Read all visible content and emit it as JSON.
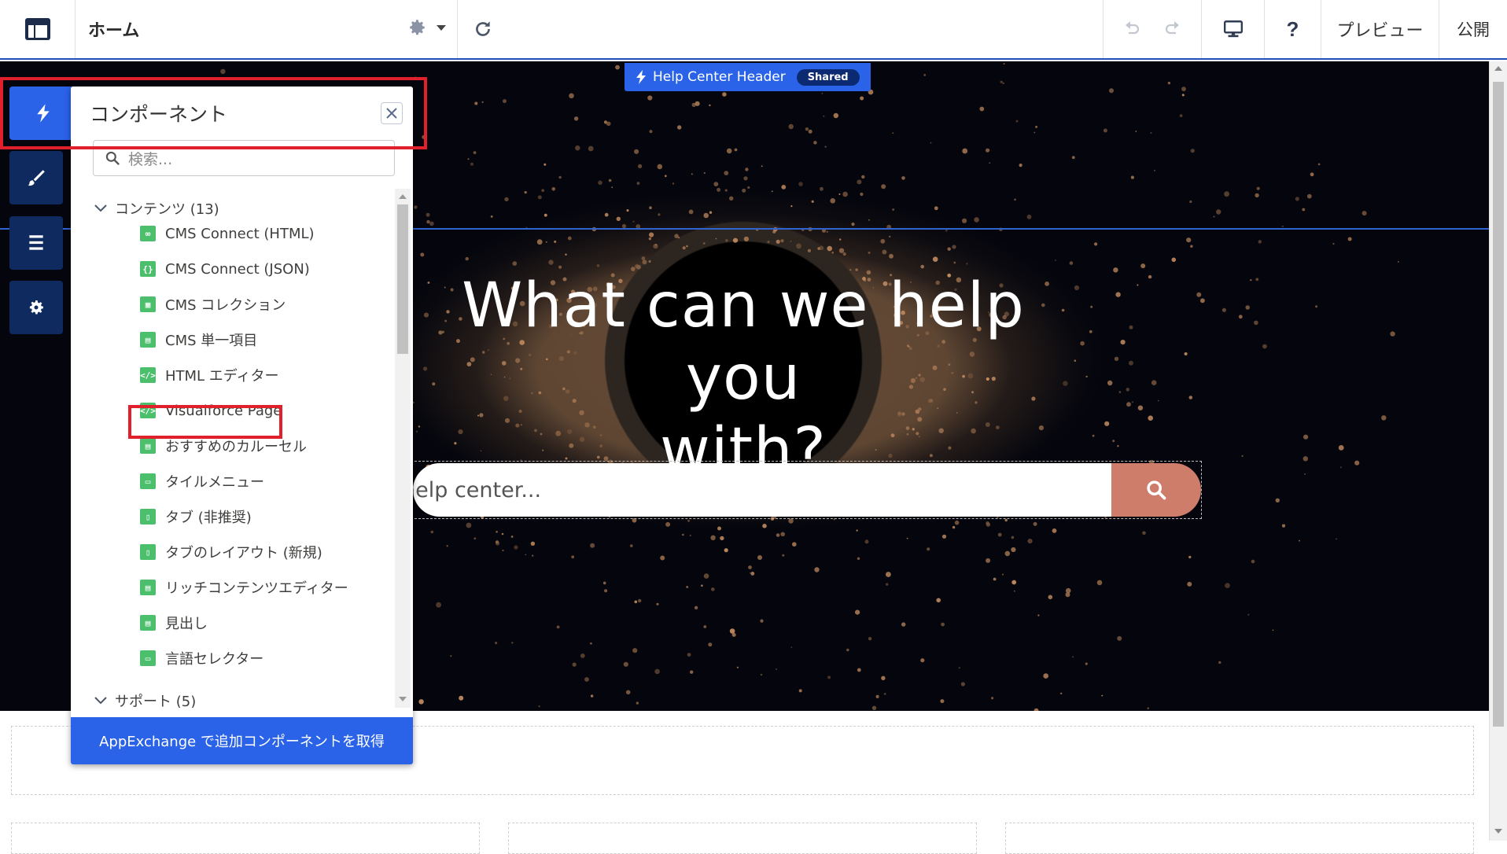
{
  "toolbar": {
    "page_name": "ホーム",
    "preview_label": "プレビュー",
    "publish_label": "公開"
  },
  "canvas": {
    "header_tag_label": "Help Center Header",
    "shared_badge": "Shared",
    "hero_title_line1": "What can we help you",
    "hero_title_line2": "with?",
    "search_placeholder": "help center..."
  },
  "panel": {
    "title": "コンポーネント",
    "search_placeholder": "検索...",
    "categories": [
      {
        "label": "コンテンツ (13)"
      },
      {
        "label": "サポート (5)"
      }
    ],
    "items": [
      {
        "label": "CMS Connect (HTML)",
        "icon": "cms-connect-html-icon"
      },
      {
        "label": "CMS Connect (JSON)",
        "icon": "cms-connect-json-icon"
      },
      {
        "label": "CMS コレクション",
        "icon": "cms-collection-icon"
      },
      {
        "label": "CMS 単一項目",
        "icon": "cms-single-item-icon"
      },
      {
        "label": "HTML エディター",
        "icon": "html-editor-icon"
      },
      {
        "label": "Visualforce Page",
        "icon": "visualforce-page-icon"
      },
      {
        "label": "おすすめのカルーセル",
        "icon": "carousel-icon"
      },
      {
        "label": "タイルメニュー",
        "icon": "tile-menu-icon"
      },
      {
        "label": "タブ (非推奨)",
        "icon": "tabs-icon"
      },
      {
        "label": "タブのレイアウト (新規)",
        "icon": "tabs-layout-icon"
      },
      {
        "label": "リッチコンテンツエディター",
        "icon": "rich-content-editor-icon"
      },
      {
        "label": "見出し",
        "icon": "heading-icon"
      },
      {
        "label": "言語セレクター",
        "icon": "language-selector-icon"
      }
    ],
    "footer_label": "AppExchange で追加コンポーネントを取得"
  },
  "colors": {
    "accent_blue": "#2a63e8",
    "rail_navy": "#0e2a5f",
    "component_green": "#4bbf6b",
    "search_button": "#cd7d69",
    "highlight_red": "#e0202a"
  }
}
